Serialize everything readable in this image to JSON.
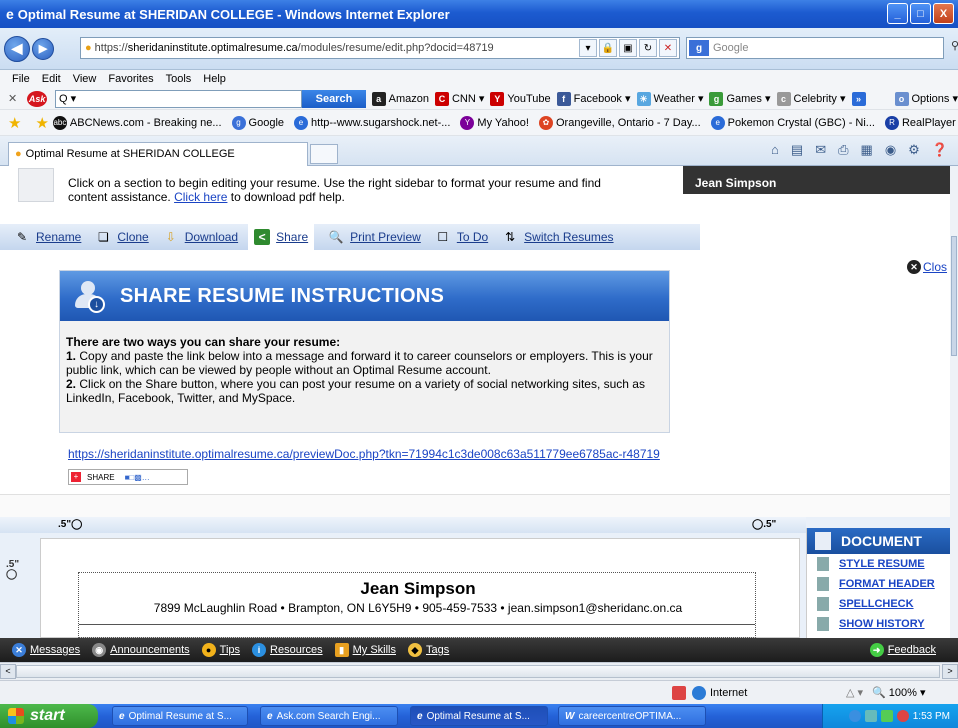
{
  "window": {
    "title": "Optimal Resume at SHERIDAN COLLEGE - Windows Internet Explorer",
    "buttons": [
      "_",
      "□",
      "X"
    ]
  },
  "address_bar": {
    "url_prefix": "https://",
    "url_domain": "sheridaninstitute.optimalresume.ca",
    "url_path": "/modules/resume/edit.php?docid=48719",
    "search_placeholder": "Google"
  },
  "menu": [
    "File",
    "Edit",
    "View",
    "Favorites",
    "Tools",
    "Help"
  ],
  "ask_toolbar": {
    "search_value": "Q ▾",
    "search_button": "Search",
    "items": [
      {
        "icon": "amazon-icon",
        "label": "Amazon"
      },
      {
        "icon": "cnn-icon",
        "label": "CNN ▾"
      },
      {
        "icon": "youtube-icon",
        "label": "YouTube"
      },
      {
        "icon": "facebook-icon",
        "label": "Facebook ▾"
      },
      {
        "icon": "weather-icon",
        "label": "Weather ▾"
      },
      {
        "icon": "games-icon",
        "label": "Games ▾"
      },
      {
        "icon": "celebrity-icon",
        "label": "Celebrity ▾"
      }
    ],
    "options": "Options ▾"
  },
  "favorites": [
    "ABCNews.com - Breaking ne...",
    "Google",
    "http--www.sugarshock.net-...",
    "My Yahoo!",
    "Orangeville, Ontario - 7 Day...",
    "Pokemon Crystal (GBC) - Ni...",
    "RealPlayer"
  ],
  "tab": {
    "label": "Optimal Resume at SHERIDAN COLLEGE"
  },
  "page": {
    "intro_text": "Click on a section to begin editing your resume. Use the right sidebar to format your resume and find",
    "intro_text2": "content assistance.",
    "click_here": "Click here",
    "intro_text3": "to download pdf help.",
    "user_name": "Jean Simpson",
    "actions": [
      {
        "label": "Rename",
        "icon": "rename-icon"
      },
      {
        "label": "Clone",
        "icon": "clone-icon"
      },
      {
        "label": "Download",
        "icon": "download-icon"
      },
      {
        "label": "Share",
        "icon": "share-icon"
      },
      {
        "label": "Print Preview",
        "icon": "print-preview-icon"
      },
      {
        "label": "To Do",
        "icon": "todo-icon"
      },
      {
        "label": "Switch Resumes",
        "icon": "switch-resumes-icon"
      }
    ],
    "close_label": "Clos",
    "share": {
      "title": "SHARE RESUME INSTRUCTIONS",
      "lead": "There are two ways you can share your resume:",
      "step1_num": "1.",
      "step1": "Copy and paste the link below into a message and forward it to career counselors or employers. This is your public link, which can be viewed by people without an Optimal Resume account.",
      "step2_num": "2.",
      "step2": "Click on the Share button, where you can post your resume on a variety of social networking sites, such as LinkedIn, Facebook, Twitter, and MySpace.",
      "link": "https://sheridaninstitute.optimalresume.ca/previewDoc.php?tkn=71994c1c3de008c63a511779ee6785ac-r48719",
      "widget_label": "SHARE"
    },
    "editor": {
      "margin_left": ".5\"",
      "margin_right": ".5\"",
      "margin_top": ".5\"",
      "resume_name": "Jean Simpson",
      "resume_contact": "7899 McLaughlin Road • Brampton, ON L6Y5H9 • 905-459-7533 • jean.simpson1@sheridanc.on.ca"
    },
    "sidebar": {
      "title": "DOCUMENT",
      "items": [
        "STYLE RESUME",
        "FORMAT HEADER",
        "SPELLCHECK",
        "SHOW HISTORY"
      ]
    },
    "bottom_bar": [
      "Messages",
      "Announcements",
      "Tips",
      "Resources",
      "My Skills",
      "Tags"
    ],
    "feedback": "Feedback"
  },
  "status": {
    "zone": "Internet",
    "zoom": " 100%"
  },
  "taskbar": {
    "start": "start",
    "items": [
      "Optimal Resume at S...",
      "Ask.com Search Engi...",
      "Optimal Resume at S...",
      "careercentreOPTIMA..."
    ],
    "time": "1:53 PM"
  }
}
